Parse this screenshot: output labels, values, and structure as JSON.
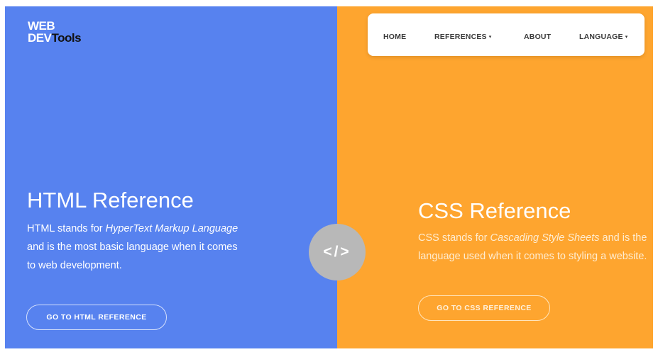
{
  "logo": {
    "line1": "WEB",
    "line2_white": "DEV",
    "line2_dark": "Tools"
  },
  "nav": {
    "items": [
      {
        "label": "HOME",
        "caret": ""
      },
      {
        "label": "REFERENCES",
        "caret": "▾"
      },
      {
        "label": "ABOUT",
        "caret": ""
      },
      {
        "label": "LANGUAGE",
        "caret": "▾"
      }
    ]
  },
  "html_ref": {
    "title": "HTML Reference",
    "desc_pre": "HTML stands for ",
    "desc_em": "HyperText Markup Language",
    "desc_post": " and is the most basic language when it comes to web development.",
    "button": "GO TO HTML REFERENCE"
  },
  "css_ref": {
    "title": "CSS Reference",
    "desc_pre": "CSS stands for ",
    "desc_em": "Cascading Style Sheets",
    "desc_post": " and is the language used when it comes to styling a website.",
    "button": "GO TO CSS REFERENCE"
  },
  "center_icon": {
    "text": "</>",
    "icon": "code-icon"
  },
  "colors": {
    "left_panel": "#5782ef",
    "right_panel": "#fea52f",
    "nav_bg": "#ffffff",
    "icon_circle": "#b8b8b8"
  }
}
